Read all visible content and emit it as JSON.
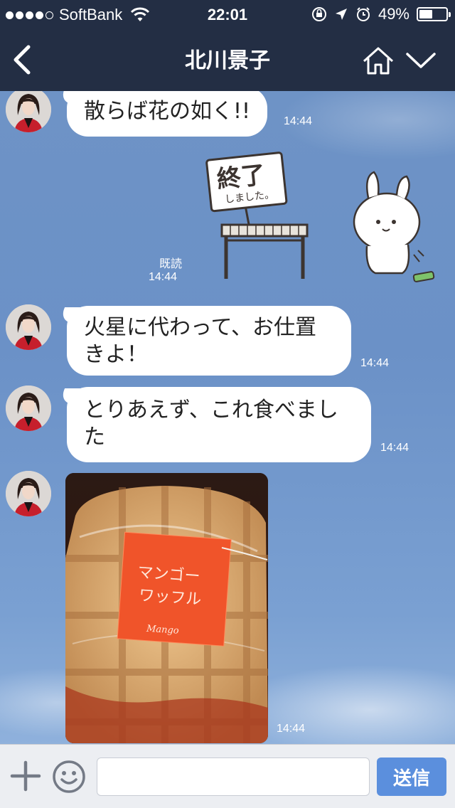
{
  "status_bar": {
    "carrier": "SoftBank",
    "time": "22:01",
    "battery_percent": "49%",
    "battery_level": 0.49,
    "signal_bars_filled": 4,
    "signal_bars_total": 5
  },
  "header": {
    "title": "北川景子"
  },
  "messages": [
    {
      "text": "散らば花の如く!!",
      "time": "14:44"
    },
    {
      "read_label": "既読",
      "time": "14:44",
      "sticker_text": "終了",
      "sticker_subtext": "しました。"
    },
    {
      "text": "火星に代わって、お仕置きよ！",
      "time": "14:44"
    },
    {
      "text": "とりあえず、これ食べました",
      "time": "14:44"
    },
    {
      "time": "14:44",
      "photo_label_1": "マンゴー",
      "photo_label_2": "ワッフル",
      "photo_label_3": "Mango"
    }
  ],
  "composer": {
    "input_value": "",
    "send_label": "送信"
  },
  "colors": {
    "header_bg": "#232e44",
    "chat_bg": "#6f94c8",
    "send_button": "#5b8fdd"
  }
}
